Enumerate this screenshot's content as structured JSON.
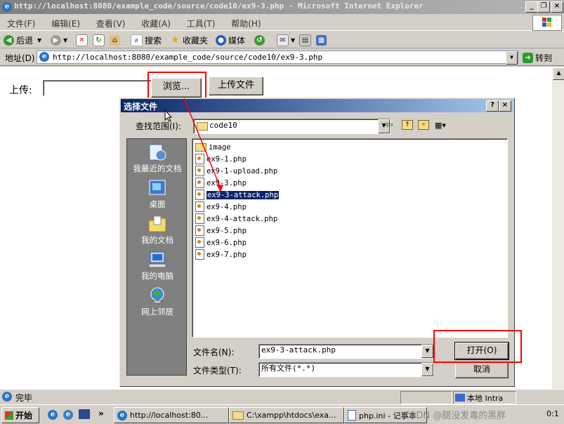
{
  "window": {
    "title": "http://localhost:8080/example_code/source/code10/ex9-3.php - Microsoft Internet Explorer",
    "buttons": [
      "_",
      "❐",
      "×"
    ]
  },
  "menu": [
    "文件(F)",
    "编辑(E)",
    "查看(V)",
    "收藏(A)",
    "工具(T)",
    "帮助(H)"
  ],
  "toolbar": {
    "back": "后退",
    "search": "搜索",
    "favorites": "收藏夹",
    "media": "媒体"
  },
  "address": {
    "label": "地址(D)",
    "url": "http://localhost:8080/example_code/source/code10/ex9-3.php",
    "go": "转到"
  },
  "page": {
    "upload_label": "上传:",
    "browse": "浏览...",
    "submit": "上传文件"
  },
  "dialog": {
    "title": "选择文件",
    "lookin_label": "查找范围(I):",
    "lookin_value": "code10",
    "places": [
      "我最近的文档",
      "桌面",
      "我的文档",
      "我的电脑",
      "网上邻居"
    ],
    "files": [
      "image",
      "ex9-1.php",
      "ex9-1-upload.php",
      "ex9-3.php",
      "ex9-3-attack.php",
      "ex9-4.php",
      "ex9-4-attack.php",
      "ex9-5.php",
      "ex9-6.php",
      "ex9-7.php"
    ],
    "selected_file": "ex9-3-attack.php",
    "filename_label": "文件名(N):",
    "filename_value": "ex9-3-attack.php",
    "filetype_label": "文件类型(T):",
    "filetype_value": "所有文件(*.*)",
    "open": "打开(O)",
    "cancel": "取消"
  },
  "status": {
    "text": "完毕",
    "zone": "本地 Intra"
  },
  "taskbar": {
    "start": "开始",
    "tasks": [
      "http://localhost:80...",
      "C:\\xampp\\htdocs\\exa...",
      "php.ini - 记事本"
    ],
    "watermark": "CSDN @腿没发毒的黑胖",
    "clock": "0:1"
  },
  "colors": {
    "highlight": "#0a246a",
    "annotation": "#ff0000"
  }
}
